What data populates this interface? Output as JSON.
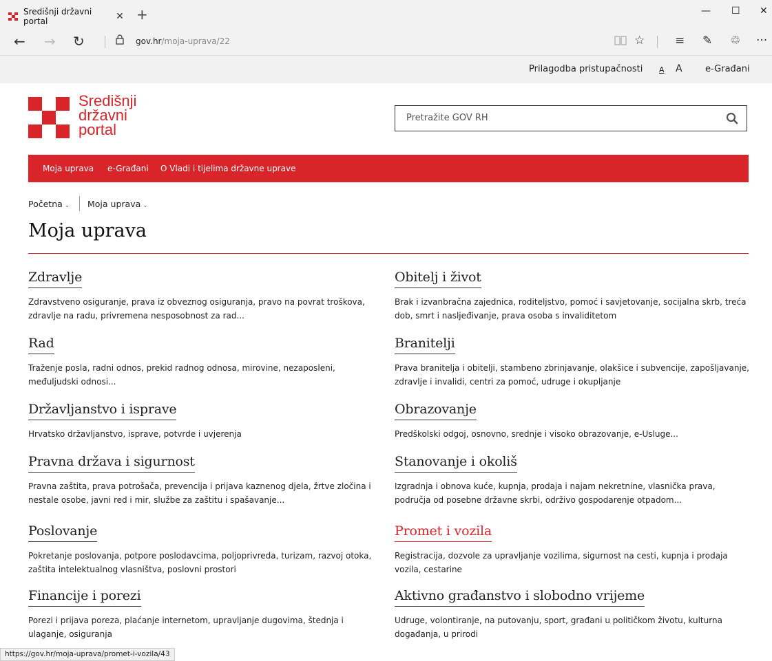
{
  "browser": {
    "tab_title": "Središnji državni portal",
    "tab_close": "✕",
    "new_tab": "+",
    "url_host": "gov.hr",
    "url_path": "/moja-uprava/22",
    "win_min": "—",
    "win_max": "☐",
    "win_close": "✕",
    "back": "←",
    "forward": "→",
    "refresh": "↻",
    "lock": "🔒",
    "reading": "▯▯",
    "favorite": "☆",
    "hub": "≡",
    "note": "✎",
    "share": "♲",
    "more": "···"
  },
  "utility": {
    "accessibility": "Prilagodba pristupačnosti",
    "font_small": "A",
    "font_large": "A",
    "egradjani": "e-Građani"
  },
  "logo": {
    "line1": "Središnji",
    "line2": "državni",
    "line3": "portal",
    "color": "#d9242a"
  },
  "search": {
    "placeholder": "Pretražite GOV RH"
  },
  "mainnav": {
    "items": [
      "Moja uprava",
      "e-Građani",
      "O Vladi i tijelima državne uprave"
    ]
  },
  "breadcrumb": {
    "home": "Početna",
    "current": "Moja uprava"
  },
  "page_title": "Moja uprava",
  "categories": {
    "left": [
      {
        "title": "Zdravlje",
        "desc": "Zdravstveno osiguranje, prava iz obveznog osiguranja, pravo na povrat troškova, zdravlje na radu, privremena nesposobnost za rad..."
      },
      {
        "title": "Rad",
        "desc": "Traženje posla, radni odnos, prekid radnog odnosa, mirovine, nezaposleni, međuljudski odnosi..."
      },
      {
        "title": "Državljanstvo i isprave",
        "desc": "Hrvatsko državljanstvo, isprave, potvrde i uvjerenja"
      },
      {
        "title": "Pravna država i sigurnost",
        "desc": "Pravna zaštita, prava potrošača, prevencija i prijava kaznenog djela, žrtve zločina i nestale osobe, javni red i mir, službe za zaštitu i spašavanje..."
      },
      {
        "title": "Poslovanje",
        "desc": "Pokretanje poslovanja, potpore poslodavcima, poljoprivreda, turizam, razvoj otoka, zaštita intelektualnog vlasništva, poslovni prostori"
      },
      {
        "title": "Financije i porezi",
        "desc": "Porezi i prijava poreza, plaćanje internetom, upravljanje dugovima, štednja i ulaganje, osiguranja"
      }
    ],
    "right": [
      {
        "title": "Obitelj i život",
        "desc": "Brak i izvanbračna zajednica, roditeljstvo, pomoć i savjetovanje, socijalna skrb, treća dob, smrt i nasljeđivanje, prava osoba s invaliditetom"
      },
      {
        "title": "Branitelji",
        "desc": "Prava branitelja i obitelji, stambeno zbrinjavanje, olakšice i subvencije, zapošljavanje, zdravlje i invalidi, centri za pomoć, udruge i okupljanje"
      },
      {
        "title": "Obrazovanje",
        "desc": "Predškolski odgoj, osnovno, srednje i visoko obrazovanje, e-Usluge..."
      },
      {
        "title": "Stanovanje i okoliš",
        "desc": "Izgradnja i obnova kuće, kupnja, prodaja i najam nekretnine, vlasnička prava, područja od posebne državne skrbi, održivo gospodarenje otpadom..."
      },
      {
        "title": "Promet i vozila",
        "desc": "Registracija, dozvole za upravljanje vozilima, sigurnost na cesti, kupnja i prodaja vozila, cestarine"
      },
      {
        "title": "Aktivno građanstvo i slobodno vrijeme",
        "desc": "Udruge, volontiranje, na putovanju, sport, građani u političkom životu, kulturna događanja, u prirodi"
      }
    ]
  },
  "status_url": "https://gov.hr/moja-uprava/promet-i-vozila/43",
  "colors": {
    "accent": "#d9242a"
  }
}
